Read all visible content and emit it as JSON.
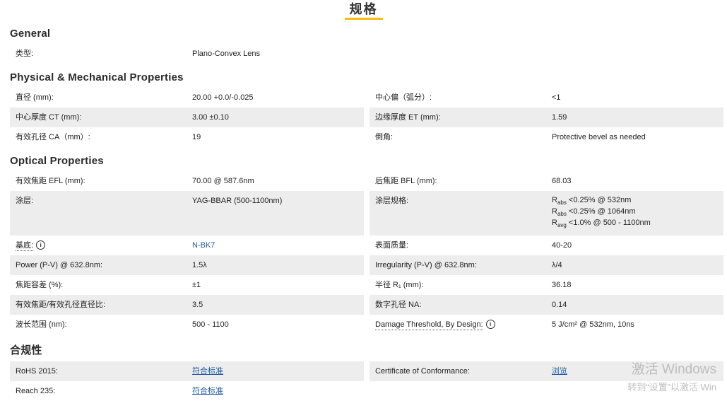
{
  "page": {
    "title": "规格"
  },
  "colors": {
    "accent_underline": "#fdb913",
    "link": "#1e5ba4",
    "row_stripe": "#ededed"
  },
  "icons": {
    "info_glyph": "i"
  },
  "sections": [
    {
      "heading": "General",
      "rows": [
        {
          "left": {
            "label": "类型:",
            "value": "Plano-Convex Lens"
          }
        }
      ]
    },
    {
      "heading": "Physical & Mechanical Properties",
      "rows": [
        {
          "left": {
            "label": "直径 (mm):",
            "value": "20.00 +0.0/-0.025"
          },
          "right": {
            "label": "中心偏（弧分）:",
            "value": "<1"
          }
        },
        {
          "left": {
            "label": "中心厚度 CT (mm):",
            "value": "3.00 ±0.10"
          },
          "right": {
            "label": "边缘厚度 ET (mm):",
            "value": "1.59"
          }
        },
        {
          "left": {
            "label": "有效孔径 CA（mm）:",
            "value": "19"
          },
          "right": {
            "label": "倒角:",
            "value": "Protective bevel as needed"
          }
        }
      ]
    },
    {
      "heading": "Optical Properties",
      "rows": [
        {
          "left": {
            "label": "有效焦距 EFL (mm):",
            "value": "70.00 @ 587.6nm"
          },
          "right": {
            "label": "后焦距 BFL (mm):",
            "value": "68.03"
          }
        },
        {
          "left": {
            "label": "涂层:",
            "value": "YAG-BBAR (500-1100nm)"
          },
          "right": {
            "label": "涂层规格:",
            "value_lines": [
              {
                "pre": "R",
                "sub": "abs",
                "post": " <0.25% @ 532nm"
              },
              {
                "pre": "R",
                "sub": "abs",
                "post": " <0.25% @ 1064nm"
              },
              {
                "pre": "R",
                "sub": "avg",
                "post": " <1.0% @ 500 - 1100nm"
              }
            ]
          }
        },
        {
          "left": {
            "label": "基底:",
            "has_info": true,
            "link": "N-BK7"
          },
          "right": {
            "label": "表面质量:",
            "value": "40-20"
          }
        },
        {
          "left": {
            "label": "Power (P-V) @ 632.8nm:",
            "value": "1.5λ"
          },
          "right": {
            "label": "Irregularity (P-V) @ 632.8nm:",
            "value": "λ/4"
          }
        },
        {
          "left": {
            "label": "焦距容差 (%):",
            "value": "±1"
          },
          "right": {
            "label": "半径 R₁ (mm):",
            "value": "36.18"
          }
        },
        {
          "left": {
            "label": "有效焦距/有效孔径直径比:",
            "value": "3.5"
          },
          "right": {
            "label": "数字孔径 NA:",
            "value": "0.14"
          }
        },
        {
          "left": {
            "label": "波长范围 (nm):",
            "value": "500 - 1100"
          },
          "right": {
            "label": "Damage Threshold, By Design:",
            "has_info": true,
            "value": "5 J/cm² @ 532nm, 10ns"
          }
        }
      ]
    },
    {
      "heading": "合规性",
      "rows": [
        {
          "left": {
            "label": "RoHS 2015:",
            "link": "符合标准"
          },
          "right": {
            "label": "Certificate of Conformance:",
            "link": "浏览"
          }
        },
        {
          "left": {
            "label": "Reach 235:",
            "link": "符合标准"
          }
        }
      ]
    }
  ],
  "watermark": {
    "line1": "激活 Windows",
    "line2": "转到“设置”以激活 Win"
  }
}
